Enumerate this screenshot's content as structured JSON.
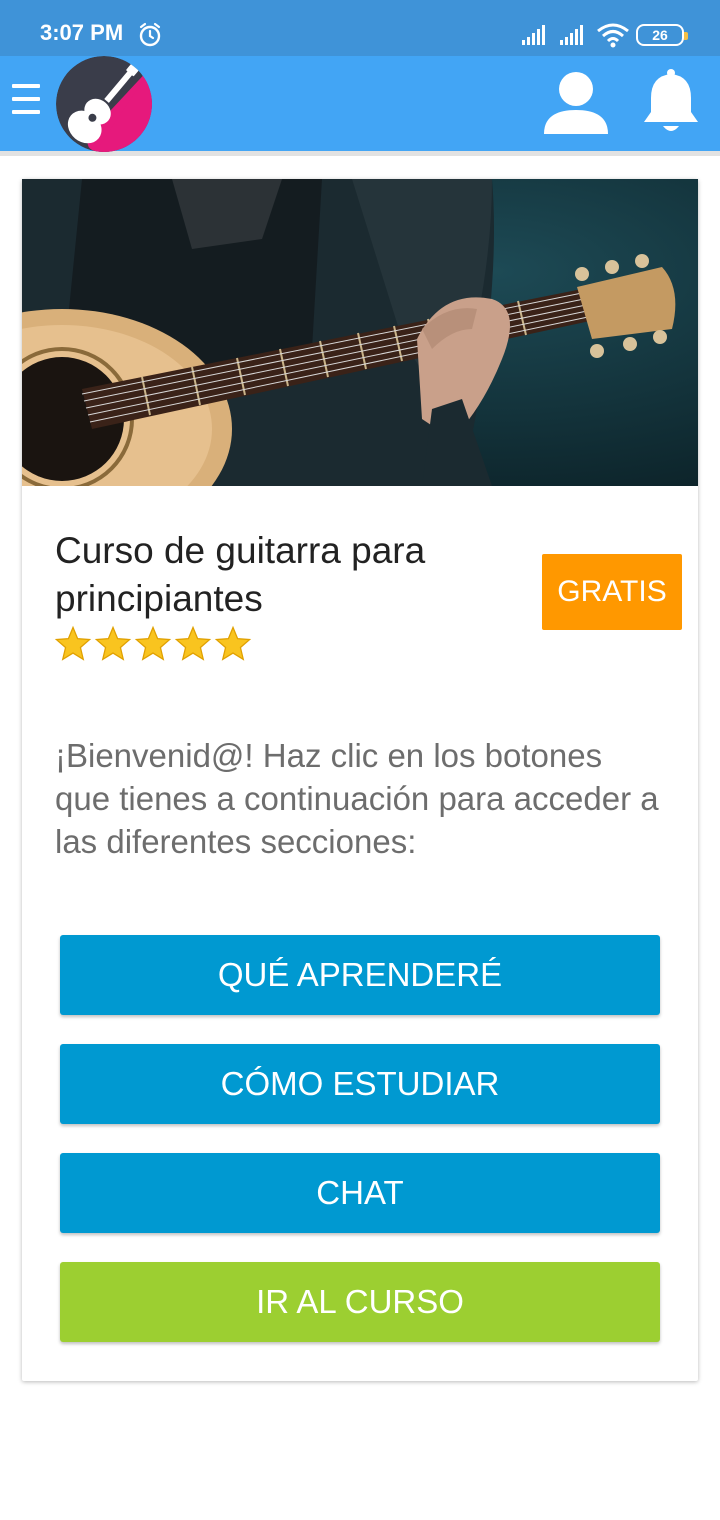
{
  "status_bar": {
    "time": "3:07 PM",
    "battery_level": "26",
    "icons": [
      "alarm-icon",
      "signal-icon",
      "signal-icon",
      "wifi-icon",
      "battery-icon"
    ]
  },
  "app_bar": {
    "icons": [
      "menu-icon",
      "guitar-logo",
      "user-icon",
      "bell-icon"
    ],
    "accent_color": "#42a5f5"
  },
  "course": {
    "title": "Curso de guitarra para principiantes",
    "badge": "GRATIS",
    "rating": 5,
    "rating_max": 5,
    "description": "¡Bienvenid@! Haz clic en los botones que tienes a continuación para acceder a las diferentes secciones:"
  },
  "buttons": [
    {
      "label": "QUÉ APRENDERÉ",
      "color": "#0099d1"
    },
    {
      "label": "CÓMO ESTUDIAR",
      "color": "#0099d1"
    },
    {
      "label": "CHAT",
      "color": "#0099d1"
    },
    {
      "label": "IR AL CURSO",
      "color": "#9ccf31"
    }
  ]
}
